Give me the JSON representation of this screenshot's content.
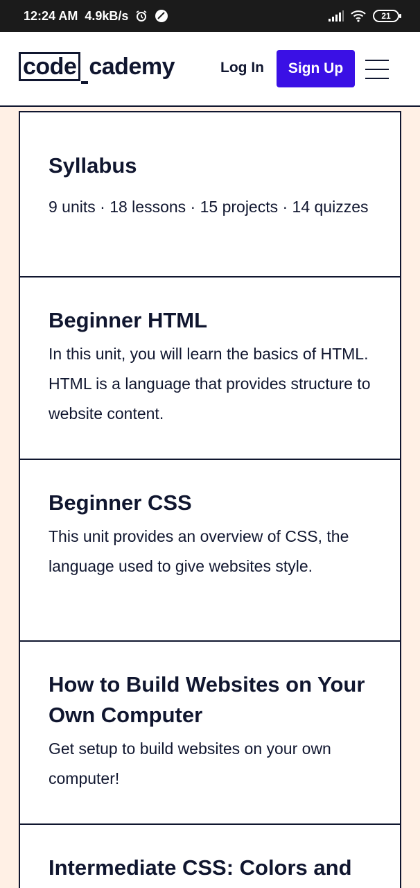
{
  "status_bar": {
    "time": "12:24 AM",
    "speed": "4.9kB/s",
    "battery": "21",
    "icons": [
      "alarm-icon",
      "sync-icon",
      "signal-icon",
      "wifi-icon",
      "battery-icon"
    ]
  },
  "header": {
    "logo_part1": "code",
    "logo_part2": "cademy",
    "login_label": "Log In",
    "signup_label": "Sign Up",
    "menu_icon": "hamburger-menu-icon",
    "accent_color": "#3a10e5"
  },
  "syllabus": {
    "title": "Syllabus",
    "meta": "9 units · 18 lessons · 15 projects · 14 quizzes"
  },
  "units": [
    {
      "title": "Beginner HTML",
      "description": "In this unit, you will learn the basics of HTML. HTML is a language that provides structure to website content."
    },
    {
      "title": "Beginner CSS",
      "description": "This unit provides an overview of CSS, the language used to give websites style."
    },
    {
      "title": "How to Build Websites on Your Own Computer",
      "description": "Get setup to build websites on your own computer!"
    },
    {
      "title": "Intermediate CSS: Colors and Typography",
      "description": ""
    }
  ],
  "colors": {
    "page_background": "#fff0e5",
    "text": "#10162f",
    "status_bar": "#1b1b1b"
  }
}
